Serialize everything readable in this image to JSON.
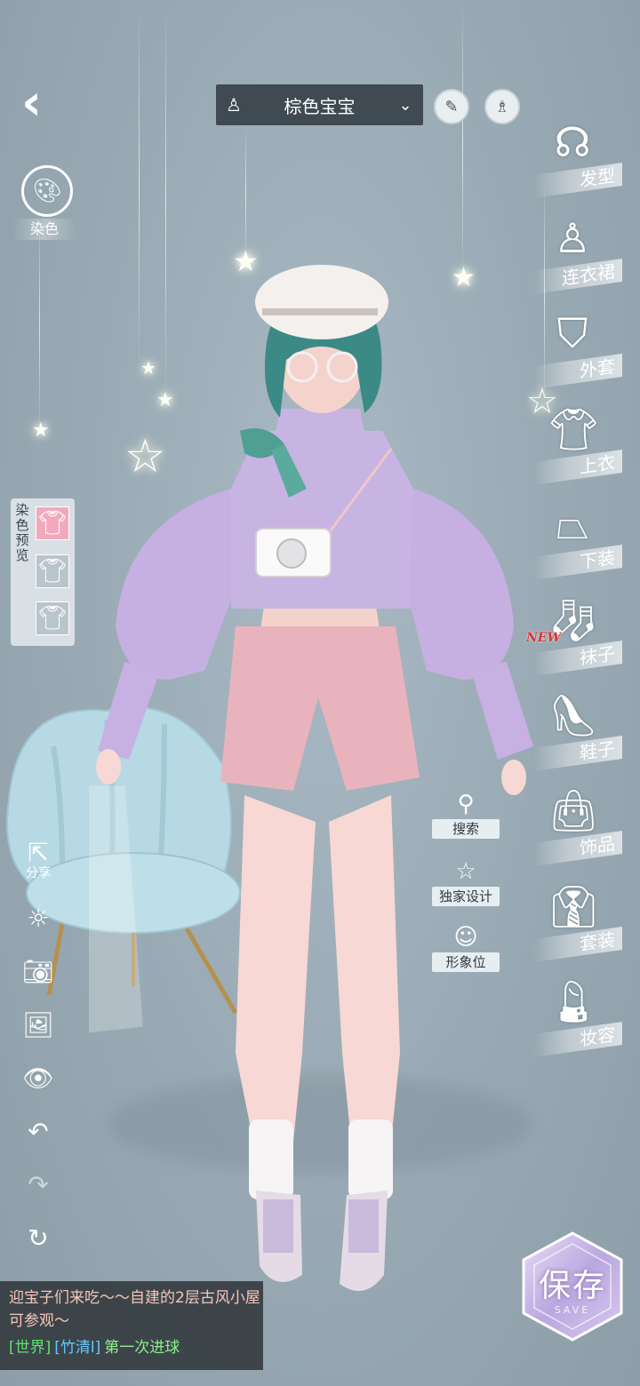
{
  "outfit_selector": {
    "name": "棕色宝宝",
    "dress_icon": "dress-icon",
    "chevron_icon": "chevron-down-icon"
  },
  "top_buttons": [
    {
      "name": "brush-icon"
    },
    {
      "name": "dress-icon"
    }
  ],
  "dye": {
    "label": "染色",
    "icon": "palette-icon"
  },
  "dye_preview": {
    "title": "染色预览",
    "slots": [
      "shirt-icon",
      "shirt-icon",
      "shirt-icon"
    ],
    "active_index": 0
  },
  "left_tools": [
    {
      "id": "share",
      "icon": "share-icon",
      "label": "分享"
    },
    {
      "id": "settings",
      "icon": "sun-icon",
      "label": ""
    },
    {
      "id": "camera",
      "icon": "camera-icon",
      "label": ""
    },
    {
      "id": "gallery",
      "icon": "image-icon",
      "label": ""
    },
    {
      "id": "visibility",
      "icon": "eye-icon",
      "label": ""
    },
    {
      "id": "undo",
      "icon": "undo-icon",
      "label": ""
    },
    {
      "id": "redo",
      "icon": "redo-icon",
      "label": ""
    },
    {
      "id": "reset",
      "icon": "reset-icon",
      "label": ""
    }
  ],
  "categories": [
    {
      "label": "发型",
      "icon": "hair-icon"
    },
    {
      "label": "连衣裙",
      "icon": "dress-icon"
    },
    {
      "label": "外套",
      "icon": "coat-icon"
    },
    {
      "label": "上衣",
      "icon": "top-icon"
    },
    {
      "label": "下装",
      "icon": "skirt-icon"
    },
    {
      "label": "袜子",
      "icon": "socks-icon",
      "badge": "NEW"
    },
    {
      "label": "鞋子",
      "icon": "heel-icon"
    },
    {
      "label": "饰品",
      "icon": "bag-icon"
    },
    {
      "label": "套装",
      "icon": "suit-icon"
    },
    {
      "label": "妆容",
      "icon": "makeup-icon"
    }
  ],
  "middle_actions": [
    {
      "label": "搜索",
      "icon": "search-icon"
    },
    {
      "label": "独家设计",
      "icon": "star-icon"
    },
    {
      "label": "形象位",
      "icon": "avatar-icon"
    }
  ],
  "save": {
    "label": "保存",
    "sub": "SAVE"
  },
  "chat": {
    "line1": "迎宝子们来吃～～自建的2层古风小屋可参观～",
    "channel": "[世界]",
    "user": "[竹清l]",
    "message": "第一次进球"
  },
  "colors": {
    "background": "#9aabb5",
    "dropdown": "#3f4a52",
    "sweater": "#c9b6e4",
    "shorts": "#e8b0bd",
    "chat_world": "#5fe36b",
    "chat_user": "#67c7ff"
  }
}
